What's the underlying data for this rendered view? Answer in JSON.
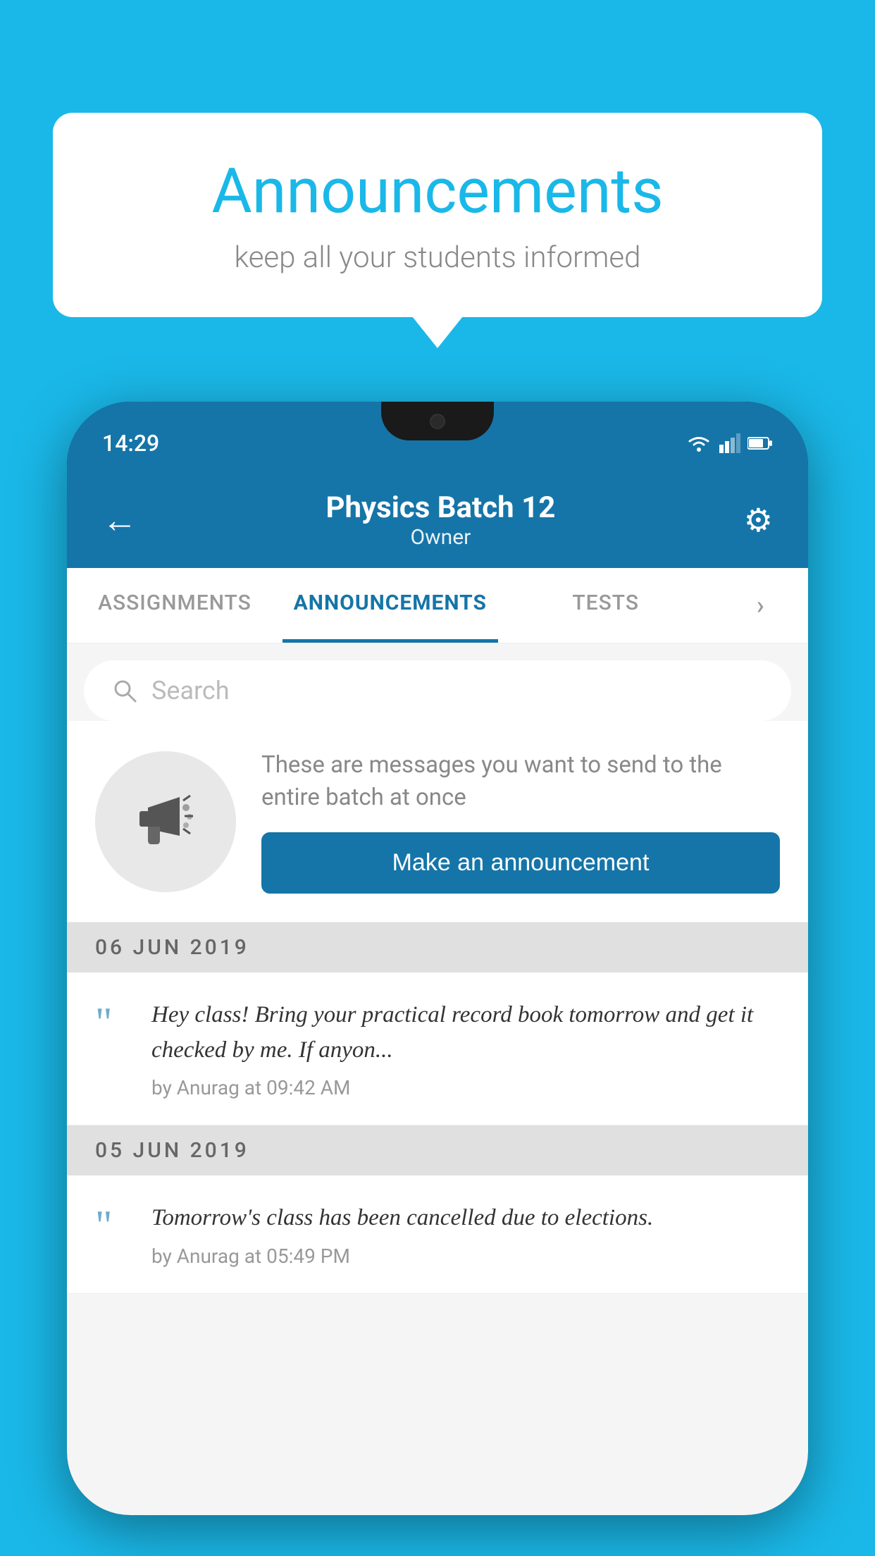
{
  "background_color": "#1ab8e8",
  "speech_bubble": {
    "title": "Announcements",
    "subtitle": "keep all your students informed"
  },
  "status_bar": {
    "time": "14:29"
  },
  "app_bar": {
    "title": "Physics Batch 12",
    "subtitle": "Owner",
    "back_label": "←",
    "gear_label": "⚙"
  },
  "tabs": [
    {
      "label": "ASSIGNMENTS",
      "active": false
    },
    {
      "label": "ANNOUNCEMENTS",
      "active": true
    },
    {
      "label": "TESTS",
      "active": false
    },
    {
      "label": "›",
      "active": false
    }
  ],
  "search": {
    "placeholder": "Search"
  },
  "promo": {
    "description": "These are messages you want to send to the entire batch at once",
    "button_label": "Make an announcement"
  },
  "date_groups": [
    {
      "date": "06  JUN  2019",
      "announcements": [
        {
          "text": "Hey class! Bring your practical record book tomorrow and get it checked by me. If anyon...",
          "meta": "by Anurag at 09:42 AM"
        }
      ]
    },
    {
      "date": "05  JUN  2019",
      "announcements": [
        {
          "text": "Tomorrow's class has been cancelled due to elections.",
          "meta": "by Anurag at 05:49 PM"
        }
      ]
    }
  ]
}
